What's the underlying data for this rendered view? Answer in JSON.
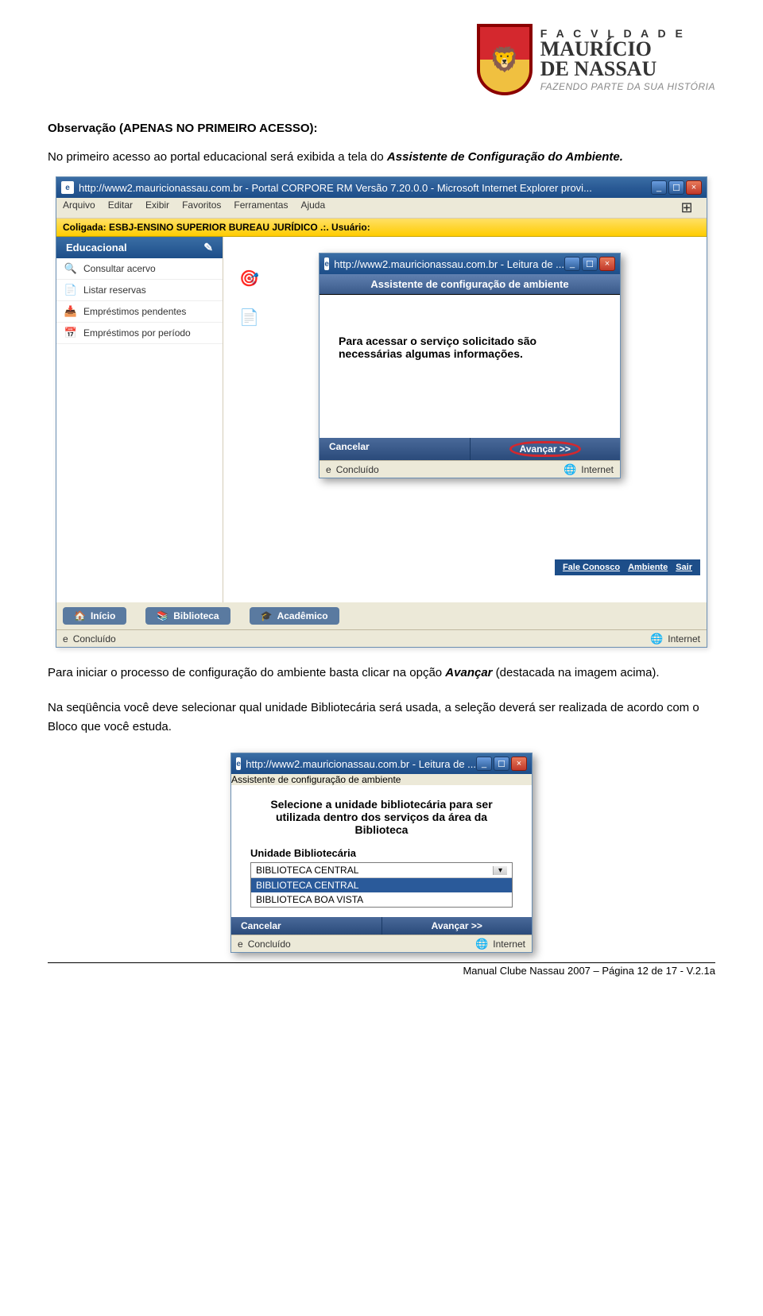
{
  "logo": {
    "faculty": "F A C V L D A D E",
    "main1": "MAURÍCIO",
    "main2": "DE NASSAU",
    "tagline": "FAZENDO PARTE DA SUA HISTÓRIA"
  },
  "intro": {
    "heading": "Observação (APENAS NO PRIMEIRO ACESSO):",
    "p1a": "No primeiro acesso ao portal educacional será exibida a tela do ",
    "p1b": "Assistente de Configuração do Ambiente.",
    "p2a": "Para iniciar o processo de configuração do ambiente basta clicar na opção ",
    "p2b": "Avançar",
    "p2c": " (destacada na imagem acima).",
    "p3": "Na seqüência você deve selecionar qual unidade Bibliotecária será usada, a seleção deverá ser realizada de acordo com o Bloco que você estuda."
  },
  "browser": {
    "title": "http://www2.mauricionassau.com.br - Portal CORPORE RM Versão 7.20.0.0 - Microsoft Internet Explorer provi...",
    "menu": [
      "Arquivo",
      "Editar",
      "Exibir",
      "Favoritos",
      "Ferramentas",
      "Ajuda"
    ],
    "coligada": "Coligada: ESBJ-ENSINO SUPERIOR BUREAU JURÍDICO .:. Usuário:",
    "sidebar_header": "Educacional",
    "sidebar": [
      {
        "icon": "🔍",
        "label": "Consultar acervo"
      },
      {
        "icon": "📄",
        "label": "Listar reservas"
      },
      {
        "icon": "📥",
        "label": "Empréstimos pendentes"
      },
      {
        "icon": "📅",
        "label": "Empréstimos por período"
      }
    ],
    "bottom_tabs": [
      {
        "icon": "🏠",
        "label": "Início"
      },
      {
        "icon": "📚",
        "label": "Biblioteca"
      },
      {
        "icon": "🎓",
        "label": "Acadêmico"
      }
    ],
    "right_links": [
      "Fale Conosco",
      "Ambiente",
      "Sair"
    ],
    "status_left": "Concluído",
    "status_right": "Internet"
  },
  "popup1": {
    "title": "http://www2.mauricionassau.com.br - Leitura de ...",
    "heading": "Assistente de configuração de ambiente",
    "body": "Para acessar o serviço solicitado são necessárias algumas informações.",
    "cancel": "Cancelar",
    "next": "Avançar >>",
    "status_left": "Concluído",
    "status_right": "Internet"
  },
  "popup2": {
    "title": "http://www2.mauricionassau.com.br - Leitura de ...",
    "heading": "Assistente de configuração de ambiente",
    "msg": "Selecione a unidade bibliotecária para ser utilizada dentro dos serviços da área da Biblioteca",
    "field_label": "Unidade Bibliotecária",
    "selected": "BIBLIOTECA CENTRAL",
    "options": [
      "BIBLIOTECA CENTRAL",
      "BIBLIOTECA BOA VISTA"
    ],
    "cancel": "Cancelar",
    "next": "Avançar >>",
    "status_left": "Concluído",
    "status_right": "Internet"
  },
  "footer": "Manual Clube Nassau 2007 – Página 12 de 17 - V.2.1a"
}
